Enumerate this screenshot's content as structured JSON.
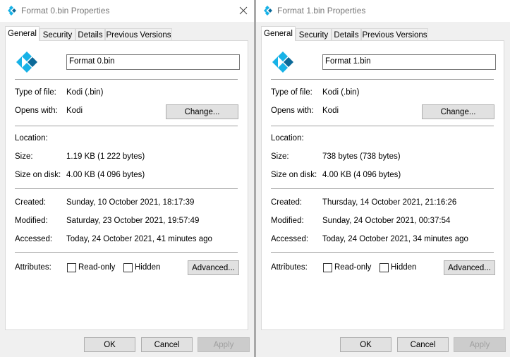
{
  "dialogs": [
    {
      "title": "Format 0.bin Properties",
      "tabs": [
        "General",
        "Security",
        "Details",
        "Previous Versions"
      ],
      "file_name": "Format 0.bin",
      "type_label": "Type of file:",
      "type_value": "Kodi (.bin)",
      "opens_label": "Opens with:",
      "opens_value": "Kodi",
      "change_button": "Change...",
      "location_label": "Location:",
      "location_value": "",
      "size_label": "Size:",
      "size_value": "1.19 KB (1 222 bytes)",
      "size_disk_label": "Size on disk:",
      "size_disk_value": "4.00 KB (4 096 bytes)",
      "created_label": "Created:",
      "created_value": "Sunday, 10 October 2021, 18:17:39",
      "modified_label": "Modified:",
      "modified_value": "Saturday, 23 October 2021, 19:57:49",
      "accessed_label": "Accessed:",
      "accessed_value": "Today, 24 October 2021, 41 minutes ago",
      "attributes_label": "Attributes:",
      "readonly_label": "Read-only",
      "hidden_label": "Hidden",
      "advanced_button": "Advanced...",
      "ok_button": "OK",
      "cancel_button": "Cancel",
      "apply_button": "Apply"
    },
    {
      "title": "Format 1.bin Properties",
      "tabs": [
        "General",
        "Security",
        "Details",
        "Previous Versions"
      ],
      "file_name": "Format 1.bin",
      "type_label": "Type of file:",
      "type_value": "Kodi (.bin)",
      "opens_label": "Opens with:",
      "opens_value": "Kodi",
      "change_button": "Change...",
      "location_label": "Location:",
      "location_value": "",
      "size_label": "Size:",
      "size_value": "738 bytes (738 bytes)",
      "size_disk_label": "Size on disk:",
      "size_disk_value": "4.00 KB (4 096 bytes)",
      "created_label": "Created:",
      "created_value": "Thursday, 14 October 2021, 21:16:26",
      "modified_label": "Modified:",
      "modified_value": "Sunday, 24 October 2021, 00:37:54",
      "accessed_label": "Accessed:",
      "accessed_value": "Today, 24 October 2021, 34 minutes ago",
      "attributes_label": "Attributes:",
      "readonly_label": "Read-only",
      "hidden_label": "Hidden",
      "advanced_button": "Advanced...",
      "ok_button": "OK",
      "cancel_button": "Cancel",
      "apply_button": "Apply"
    }
  ],
  "icons": {
    "app": "kodi-icon",
    "close": "close-icon"
  },
  "colors": {
    "kodi_blue": "#17b2e7",
    "kodi_dark": "#0c6a99",
    "title_gray": "#777777"
  }
}
